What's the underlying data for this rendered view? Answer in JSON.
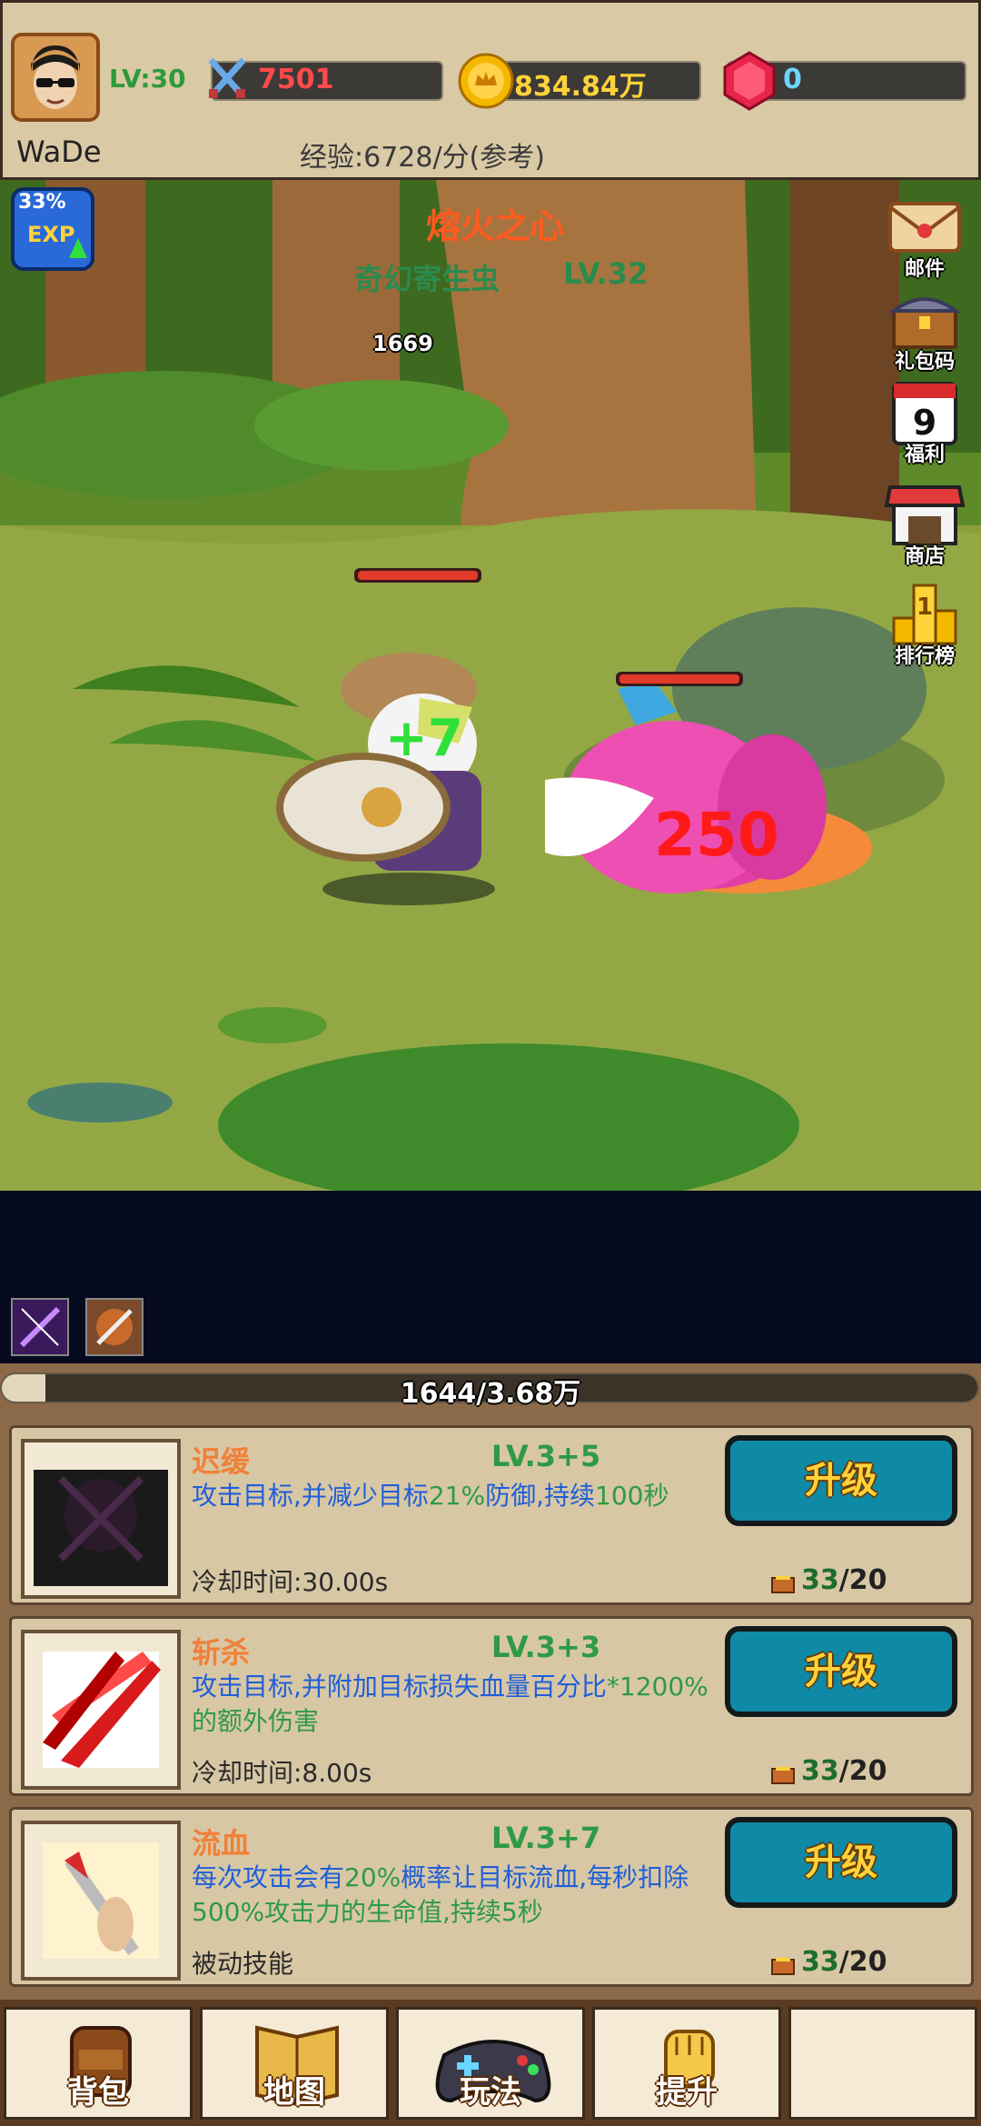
{
  "header": {
    "level": "LV:30",
    "username": "WaDe",
    "power": "7501",
    "gold": "834.84万",
    "gems": "0",
    "exp_rate": "经验:6728/分(参考)"
  },
  "scene": {
    "exp_boost_percent": "33%",
    "exp_badge": "EXP",
    "boss_title": "熔火之心",
    "enemy_name": "奇幻寄生虫",
    "enemy_level": "LV.32",
    "player_hp": "1669",
    "heal_popup": "+7",
    "damage_popup": "250",
    "side_menu": [
      {
        "label": "邮件",
        "icon": "mail-icon"
      },
      {
        "label": "礼包码",
        "icon": "treasure-chest-icon"
      },
      {
        "label": "福利",
        "icon": "calendar-icon",
        "badge": "9"
      },
      {
        "label": "商店",
        "icon": "shop-icon"
      },
      {
        "label": "排行榜",
        "icon": "trophy-icon",
        "badge": "1"
      }
    ]
  },
  "progress": {
    "text": "1644/3.68万",
    "fraction": 0.0447
  },
  "skills": [
    {
      "name": "迟缓",
      "level": "LV.3+5",
      "desc_parts": [
        "攻击目标,并减少目标",
        "21%",
        "防御,持续",
        "100秒"
      ],
      "footer": "冷却时间:30.00s",
      "upgrade": "升级",
      "cost_have": "33",
      "cost_need": "/20",
      "icon": "slow-skill-icon"
    },
    {
      "name": "斩杀",
      "level": "LV.3+3",
      "desc_parts": [
        "攻击目标,并附加目标损失血量百分比",
        "*1200",
        "%的额外伤害",
        ""
      ],
      "footer": "冷却时间:8.00s",
      "upgrade": "升级",
      "cost_have": "33",
      "cost_need": "/20",
      "icon": "execute-skill-icon"
    },
    {
      "name": "流血",
      "level": "LV.3+7",
      "desc_parts": [
        "每次攻击会有",
        "20%",
        "概率让目标流血,每秒扣除",
        "500%攻击力的生命值,持续5秒"
      ],
      "footer": "被动技能",
      "upgrade": "升级",
      "cost_have": "33",
      "cost_need": "/20",
      "icon": "bleed-skill-icon"
    }
  ],
  "nav": [
    {
      "label": "背包",
      "icon": "backpack-icon"
    },
    {
      "label": "地图",
      "icon": "map-icon"
    },
    {
      "label": "玩法",
      "icon": "gamepad-icon"
    },
    {
      "label": "提升",
      "icon": "fist-icon"
    },
    {
      "label": "",
      "icon": ""
    }
  ],
  "colors": {
    "gold": "#ffd23a",
    "upgrade_btn": "#0f8aa6",
    "boss_title": "#ff5a1f",
    "enemy_name": "#2b8a4d",
    "damage": "#ff1a1a",
    "heal": "#2fe03a"
  }
}
